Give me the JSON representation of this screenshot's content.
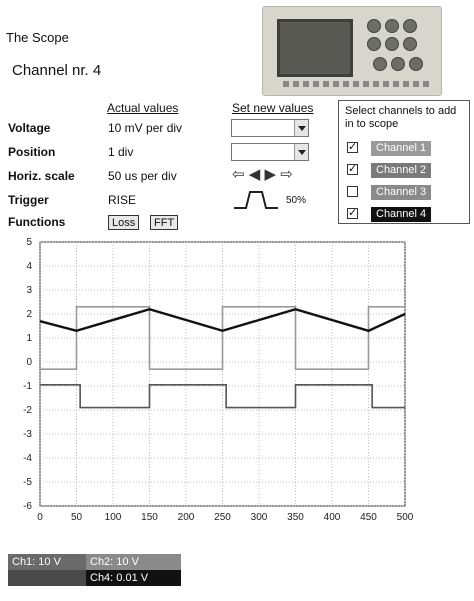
{
  "app": {
    "title": "The Scope"
  },
  "channel": {
    "title": "Channel nr. 4"
  },
  "headers": {
    "actual": "Actual values",
    "set_new": "Set new values"
  },
  "rows": [
    {
      "label": "Voltage",
      "value": "10 mV per div"
    },
    {
      "label": "Position",
      "value": "1 div"
    },
    {
      "label": "Horiz. scale",
      "value": "50 us per div"
    },
    {
      "label": "Trigger",
      "value": "RISE"
    },
    {
      "label": "Functions",
      "value": ""
    }
  ],
  "functions": {
    "loss": "Loss",
    "fft": "FFT"
  },
  "trigger": {
    "level": "50%"
  },
  "channel_select": {
    "header": "Select channels to add in to scope",
    "channels": [
      {
        "label": "Channel 1",
        "checked": true,
        "color": "#9a9a9a"
      },
      {
        "label": "Channel 2",
        "checked": true,
        "color": "#7a7a7a"
      },
      {
        "label": "Channel 3",
        "checked": false,
        "color": "#8a8a8a"
      },
      {
        "label": "Channel 4",
        "checked": true,
        "color": "#111111"
      }
    ]
  },
  "status": {
    "ch1": "Ch1: 10 V",
    "ch2": "Ch2: 10 V",
    "ch4": "Ch4: 0.01 V"
  },
  "chart_data": {
    "type": "line",
    "xlim": [
      0,
      500
    ],
    "ylim": [
      -6,
      5
    ],
    "xticks": [
      0,
      50,
      100,
      150,
      200,
      250,
      300,
      350,
      400,
      450,
      500
    ],
    "yticks": [
      5,
      4,
      3,
      2,
      1,
      0,
      -1,
      -2,
      -3,
      -4,
      -5,
      -6
    ],
    "grid": true,
    "series": [
      {
        "color": "#9a9a9a",
        "x": [
          0,
          50,
          50,
          150,
          150,
          250,
          250,
          350,
          350,
          450,
          450,
          500
        ],
        "y": [
          -0.3,
          -0.3,
          2.3,
          2.3,
          -0.3,
          -0.3,
          2.3,
          2.3,
          -0.3,
          -0.3,
          2.3,
          2.3
        ]
      },
      {
        "color": "#555555",
        "x": [
          0,
          55,
          55,
          150,
          150,
          255,
          255,
          350,
          350,
          455,
          455,
          500
        ],
        "y": [
          -0.95,
          -0.95,
          -1.9,
          -1.9,
          -0.95,
          -0.95,
          -1.9,
          -1.9,
          -0.95,
          -0.95,
          -1.9,
          -1.9
        ]
      },
      {
        "color": "#111111",
        "x": [
          0,
          50,
          150,
          250,
          350,
          450,
          500
        ],
        "y": [
          1.7,
          1.3,
          2.2,
          1.3,
          2.2,
          1.3,
          2.0
        ]
      }
    ]
  }
}
